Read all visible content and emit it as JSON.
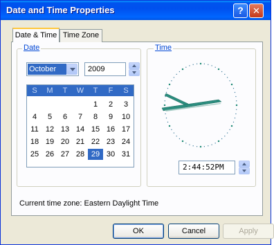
{
  "window": {
    "title": "Date and Time Properties",
    "help_glyph": "?",
    "close_glyph": "✕"
  },
  "tabs": [
    {
      "label": "Date & Time",
      "active": true
    },
    {
      "label": "Time Zone",
      "active": false
    }
  ],
  "date_group": {
    "label": "Date",
    "month": "October",
    "year": "2009",
    "weekdays": [
      "S",
      "M",
      "T",
      "W",
      "T",
      "F",
      "S"
    ],
    "weeks": [
      [
        "",
        "",
        "",
        "",
        "1",
        "2",
        "3"
      ],
      [
        "4",
        "5",
        "6",
        "7",
        "8",
        "9",
        "10"
      ],
      [
        "11",
        "12",
        "13",
        "14",
        "15",
        "16",
        "17"
      ],
      [
        "18",
        "19",
        "20",
        "21",
        "22",
        "23",
        "24"
      ],
      [
        "25",
        "26",
        "27",
        "28",
        "29",
        "30",
        "31"
      ]
    ],
    "selected_day": "29"
  },
  "time_group": {
    "label": "Time",
    "time_value": "2:44:52PM"
  },
  "timezone": {
    "text": "Current time zone:  Eastern Daylight Time"
  },
  "buttons": {
    "ok": "OK",
    "cancel": "Cancel",
    "apply": "Apply"
  },
  "colors": {
    "accent": "#316ac5",
    "clock_hand": "#2b8c7e",
    "title_bar": "#0054e3"
  },
  "icons": {
    "help": "help-icon",
    "close": "close-icon",
    "dropdown": "chevron-down-icon"
  }
}
